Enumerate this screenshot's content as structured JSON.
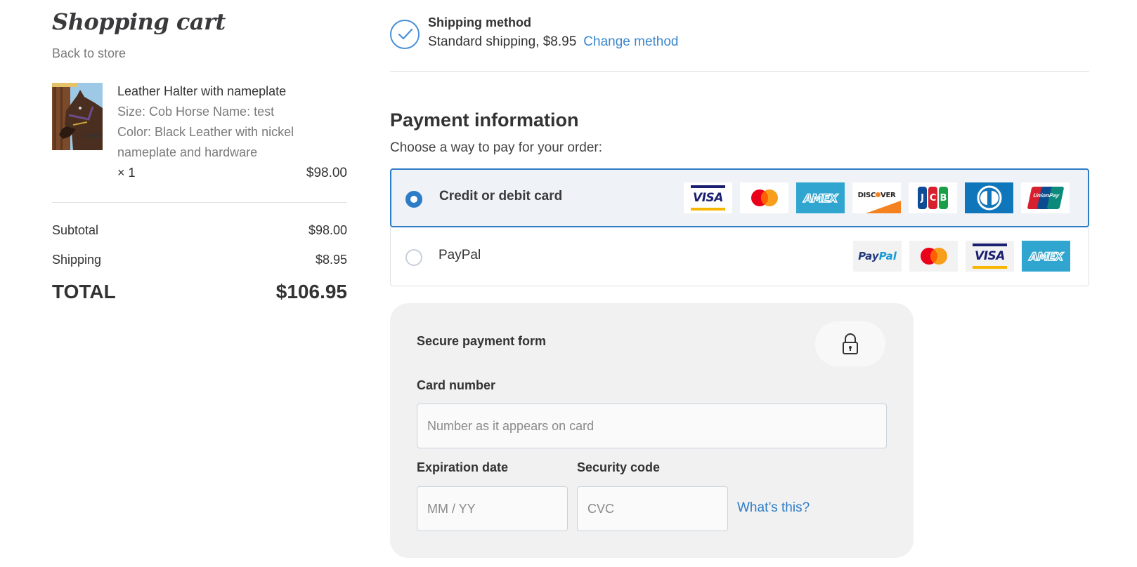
{
  "cart": {
    "title": "Shopping cart",
    "back_link": "Back to store",
    "item": {
      "name": "Leather Halter with nameplate",
      "options_line1": "Size: Cob  Horse Name: test",
      "options_line2": "Color: Black Leather with nickel",
      "options_line3": "nameplate and hardware",
      "quantity": "× 1",
      "price": "$98.00",
      "image_icon": "horse-photo"
    },
    "summary": {
      "subtotal_label": "Subtotal",
      "subtotal_value": "$98.00",
      "shipping_label": "Shipping",
      "shipping_value": "$8.95",
      "total_label": "TOTAL",
      "total_value": "$106.95"
    }
  },
  "shipping": {
    "icon": "check-circle-icon",
    "title": "Shipping method",
    "description": "Standard shipping, $8.95",
    "change_link": "Change method"
  },
  "payment": {
    "title": "Payment information",
    "subtitle": "Choose a way to pay for your order:",
    "options": [
      {
        "label": "Credit or debit card",
        "selected": true,
        "logos": [
          "VISA",
          "Mastercard",
          "AMEX",
          "DISCOVER",
          "JCB",
          "Diners Club",
          "UnionPay"
        ]
      },
      {
        "label": "PayPal",
        "selected": false,
        "logos": [
          "PayPal",
          "Mastercard",
          "VISA",
          "AMEX"
        ]
      }
    ],
    "logo_text": {
      "visa": "VISA",
      "amex": "AMEX",
      "discover_a": "DISC",
      "discover_b": "VER",
      "jcb_j": "J",
      "jcb_c": "C",
      "jcb_b": "B",
      "unionpay": "UnionPay",
      "paypal_a": "Pay",
      "paypal_b": "Pal"
    },
    "colors": {
      "accent": "#2d7cc7",
      "link": "#3a86cc",
      "selected_bg": "#eff2f7",
      "form_bg": "#f1f1f1"
    }
  },
  "secure_form": {
    "title": "Secure payment form",
    "lock_icon": "lock-icon",
    "card_number_label": "Card number",
    "card_number_placeholder": "Number as it appears on card",
    "card_number_value": "",
    "expiration_label": "Expiration date",
    "expiration_placeholder": "MM / YY",
    "expiration_value": "",
    "security_label": "Security code",
    "security_placeholder": "CVC",
    "security_value": "",
    "whats_this": "What’s this?"
  }
}
